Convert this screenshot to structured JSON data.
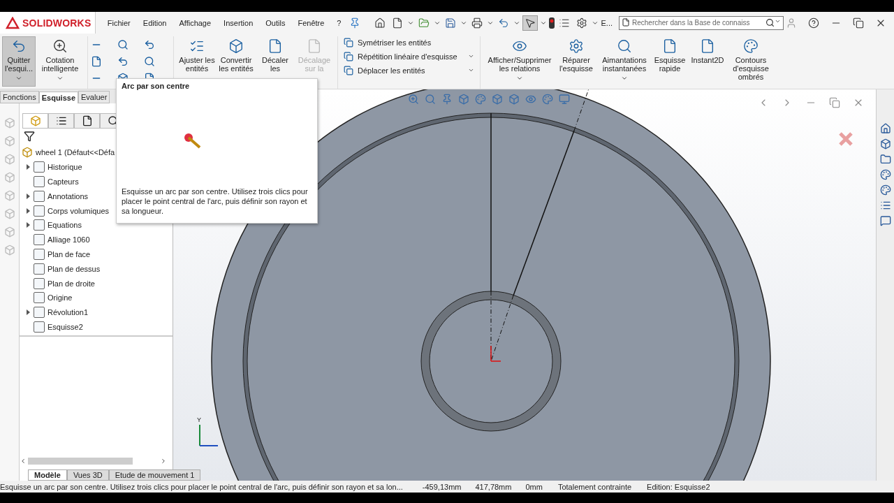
{
  "app": {
    "logo": "SOLIDWORKS"
  },
  "menu": [
    "Fichier",
    "Edition",
    "Affichage",
    "Insertion",
    "Outils",
    "Fenêtre",
    "?"
  ],
  "toolbar": {
    "label": "E...",
    "search": {
      "placeholder": "Rechercher dans la Base de connaiss"
    }
  },
  "ribbon": {
    "left_buttons": [
      {
        "label": "Quitter l'esqui...",
        "selected": true,
        "disabled": false,
        "dropdown": true
      },
      {
        "label": "Cotation intelligente",
        "selected": false,
        "disabled": false,
        "dropdown": true
      }
    ],
    "middle_buttons": [
      {
        "label": "Ajuster les entités",
        "selected": false,
        "disabled": false,
        "dropdown": false
      },
      {
        "label": "Convertir les entités",
        "selected": false,
        "disabled": false,
        "dropdown": false
      },
      {
        "label": "Décaler les",
        "selected": false,
        "disabled": false,
        "dropdown": false
      },
      {
        "label": "Décalage sur la",
        "selected": false,
        "disabled": true,
        "dropdown": false
      }
    ],
    "list_buttons": [
      {
        "label": "Symétriser les entités",
        "dropdown": false
      },
      {
        "label": "Répétition linéaire d'esquisse",
        "dropdown": true
      },
      {
        "label": "Déplacer les entités",
        "dropdown": true
      }
    ],
    "right_buttons": [
      {
        "label": "Afficher/Supprimer les relations",
        "selected": false,
        "disabled": false,
        "dropdown": true
      },
      {
        "label": "Réparer l'esquisse",
        "selected": false,
        "disabled": false,
        "dropdown": false
      },
      {
        "label": "Aimantations instantanées",
        "selected": false,
        "disabled": false,
        "dropdown": true
      },
      {
        "label": "Esquisse rapide",
        "selected": false,
        "disabled": false,
        "dropdown": false
      },
      {
        "label": "Instant2D",
        "selected": false,
        "disabled": false,
        "dropdown": false
      },
      {
        "label": "Contours d'esquisse ombrés",
        "selected": false,
        "disabled": false,
        "dropdown": false
      }
    ]
  },
  "command_tabs": [
    {
      "label": "Fonctions",
      "selected": false
    },
    {
      "label": "Esquisse",
      "selected": true
    },
    {
      "label": "Evaluer",
      "selected": false
    }
  ],
  "tooltip": {
    "title": "Arc par son centre",
    "description": "Esquisse un arc par son centre. Utilisez trois clics pour placer le point central de l'arc, puis définir son rayon et sa longueur."
  },
  "tree": {
    "root": "wheel 1  (Défaut<<Défa",
    "items": [
      {
        "label": "Historique",
        "expandable": true
      },
      {
        "label": "Capteurs",
        "expandable": false
      },
      {
        "label": "Annotations",
        "expandable": true
      },
      {
        "label": "Corps volumiques",
        "expandable": true
      },
      {
        "label": "Equations",
        "expandable": true
      },
      {
        "label": "Alliage 1060",
        "expandable": false
      },
      {
        "label": "Plan de face",
        "expandable": false
      },
      {
        "label": "Plan de dessus",
        "expandable": false
      },
      {
        "label": "Plan de droite",
        "expandable": false
      },
      {
        "label": "Origine",
        "expandable": false
      },
      {
        "label": "Révolution1",
        "expandable": true
      },
      {
        "label": "Esquisse2",
        "expandable": false
      }
    ]
  },
  "axis_label": "Y",
  "model_tabs": [
    {
      "label": "Modèle",
      "selected": true
    },
    {
      "label": "Vues 3D",
      "selected": false
    },
    {
      "label": "Etude de mouvement 1",
      "selected": false
    }
  ],
  "status_bar": [
    "Esquisse un arc par son centre. Utilisez trois clics pour placer le point central de l'arc, puis définir son rayon et sa lon...",
    "-459,13mm",
    "417,78mm",
    "0mm",
    "Totalement contrainte",
    "Edition: Esquisse2"
  ]
}
